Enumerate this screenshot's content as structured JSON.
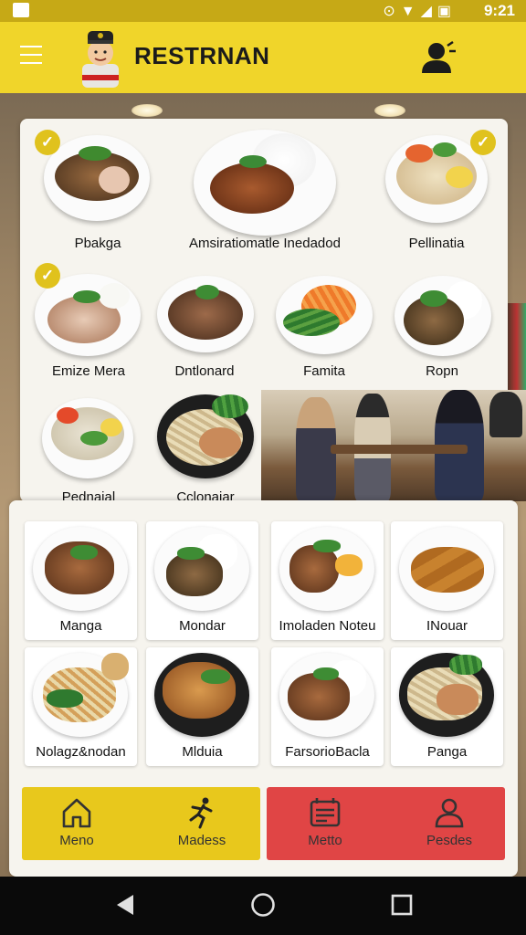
{
  "status_bar": {
    "time": "9:21"
  },
  "app_bar": {
    "title": "RESTRNAN"
  },
  "colors": {
    "accent": "#f0d52a",
    "nav_yellow": "#e8c81c",
    "nav_red": "#e04545",
    "card": "#f6f4ee"
  },
  "featured": [
    {
      "label": "Pbakga",
      "checked": true
    },
    {
      "label": "Amsiratiomatle Inedadod",
      "checked": false
    },
    {
      "label": "Pellinatia",
      "checked": true
    },
    {
      "label": "Emize Mera",
      "checked": true
    },
    {
      "label": "Dntlonard",
      "checked": false
    },
    {
      "label": "Famita",
      "checked": false
    },
    {
      "label": "Ropn",
      "checked": false
    },
    {
      "label": "Pednaial",
      "checked": false
    },
    {
      "label": "Cclonaiar",
      "checked": false
    }
  ],
  "menu_grid": [
    {
      "label": "Manga"
    },
    {
      "label": "Mondar"
    },
    {
      "label": "Imoladen Noteu"
    },
    {
      "label": "INouar"
    },
    {
      "label": "Nolagz&nodan"
    },
    {
      "label": "Mlduia"
    },
    {
      "label": "FarsorioBacla"
    },
    {
      "label": "Panga"
    }
  ],
  "bottom_nav": [
    {
      "label": "Meno",
      "icon": "home-icon"
    },
    {
      "label": "Madess",
      "icon": "running-person-icon"
    },
    {
      "label": "Metto",
      "icon": "menu-board-icon"
    },
    {
      "label": "Pesdes",
      "icon": "person-icon"
    }
  ]
}
